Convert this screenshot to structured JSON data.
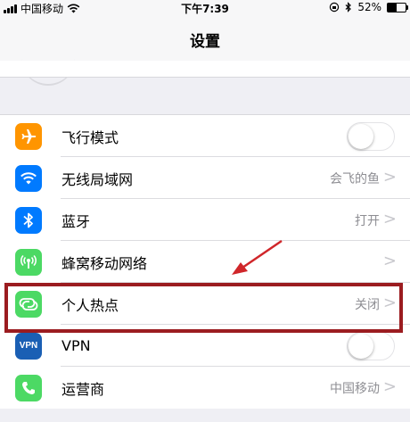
{
  "status_bar": {
    "carrier": "中国移动",
    "time": "下午7:39",
    "battery": "52%",
    "battery_level": 0.52
  },
  "nav": {
    "title": "设置"
  },
  "settings": [
    {
      "label": "飞行模式",
      "icon": "airplane-icon",
      "color": "#ff9500",
      "toggle": "off"
    },
    {
      "label": "无线局域网",
      "icon": "wifi-icon",
      "color": "#007aff",
      "value": "会飞的鱼"
    },
    {
      "label": "蓝牙",
      "icon": "bluetooth-icon",
      "color": "#007aff",
      "value": "打开"
    },
    {
      "label": "蜂窝移动网络",
      "icon": "cellular-icon",
      "color": "#4cd964",
      "value": ""
    },
    {
      "label": "个人热点",
      "icon": "hotspot-icon",
      "color": "#4cd964",
      "value": "关闭"
    },
    {
      "label": "VPN",
      "icon": "vpn-icon",
      "color": "#1a5fb4",
      "icon_text": "VPN",
      "toggle": "off"
    },
    {
      "label": "运营商",
      "icon": "phone-icon",
      "color": "#4cd964",
      "value": "中国移动"
    }
  ],
  "annotation": {
    "highlight_color": "#9b1c20",
    "arrow_color": "#d0262a"
  }
}
